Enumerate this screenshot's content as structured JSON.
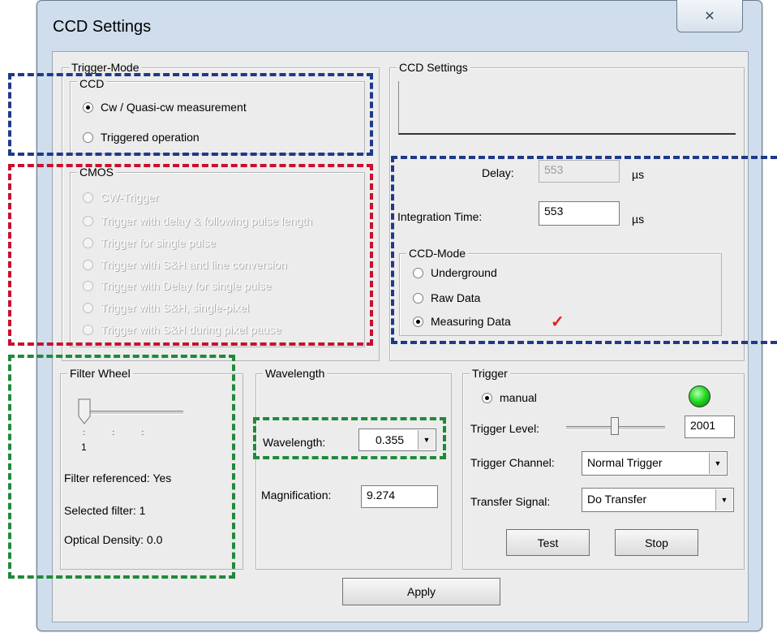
{
  "window": {
    "title": "CCD Settings",
    "close_glyph": "✕"
  },
  "trigger_mode": {
    "legend": "Trigger-Mode",
    "ccd": {
      "legend": "CCD",
      "options": [
        {
          "label": "Cw / Quasi-cw measurement",
          "selected": true
        },
        {
          "label": "Triggered operation",
          "selected": false
        }
      ]
    },
    "cmos": {
      "legend": "CMOS",
      "options": [
        "CW-Trigger",
        "Trigger with delay & following pulse length",
        "Trigger for single pulse",
        "Trigger with S&H and line conversion",
        "Trigger with Delay for single pulse",
        "Trigger with S&H, single-pixel",
        "Trigger with S&H during pixel pause"
      ]
    }
  },
  "ccd_settings": {
    "legend": "CCD Settings",
    "delay": {
      "label": "Delay:",
      "value": "553",
      "unit": "µs"
    },
    "integration_time": {
      "label": "Integration Time:",
      "value": "553",
      "unit": "µs"
    },
    "ccd_mode": {
      "legend": "CCD-Mode",
      "options": [
        {
          "label": "Underground",
          "selected": false
        },
        {
          "label": "Raw Data",
          "selected": false
        },
        {
          "label": "Measuring Data",
          "selected": true
        }
      ],
      "check_mark": "✓"
    }
  },
  "filter_wheel": {
    "legend": "Filter Wheel",
    "slider_value": "1",
    "slider_level": 0,
    "referenced": "Filter referenced: Yes",
    "selected": "Selected filter: 1",
    "optical_density": "Optical Density:  0.0"
  },
  "wavelength": {
    "legend": "Wavelength",
    "wavelength_label": "Wavelength:",
    "wavelength_value": "0.355",
    "magnification_label": "Magnification:",
    "magnification_value": "9.274"
  },
  "trigger": {
    "legend": "Trigger",
    "manual_label": "manual",
    "manual_selected": true,
    "level_label": "Trigger Level:",
    "level_value": "2001",
    "channel_label": "Trigger Channel:",
    "channel_value": "Normal Trigger",
    "transfer_label": "Transfer Signal:",
    "transfer_value": "Do Transfer",
    "test_label": "Test",
    "stop_label": "Stop",
    "indicator_color": "#22dd22"
  },
  "apply_label": "Apply",
  "colors": {
    "highlight_blue": "#1f3a8a",
    "highlight_red": "#c8102e",
    "highlight_green": "#1f8a3a"
  }
}
